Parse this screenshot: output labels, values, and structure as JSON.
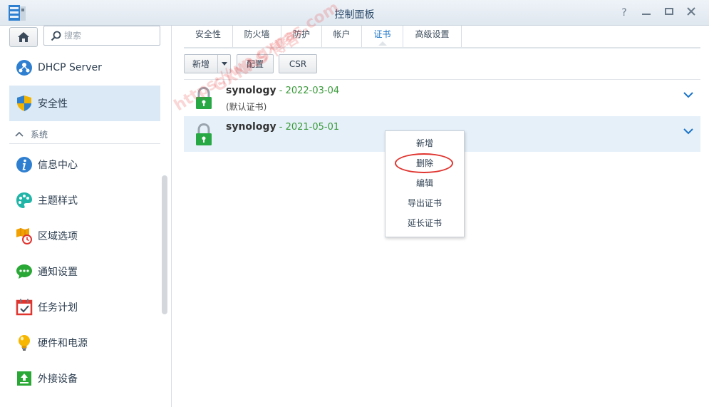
{
  "window": {
    "title": "控制面板",
    "controls": [
      "help-icon",
      "minimize-icon",
      "maximize-icon",
      "close-icon"
    ]
  },
  "sidebar": {
    "search_placeholder": "搜索",
    "items_top": [
      {
        "label": "DHCP Server",
        "icon": "dhcp-network-icon"
      },
      {
        "label": "安全性",
        "icon": "security-shield-icon",
        "active": true
      }
    ],
    "section": {
      "label": "系统",
      "icon": "chevron-up-icon"
    },
    "items": [
      {
        "label": "信息中心",
        "icon": "info-center-icon"
      },
      {
        "label": "主题样式",
        "icon": "theme-palette-icon"
      },
      {
        "label": "区域选项",
        "icon": "regional-options-icon"
      },
      {
        "label": "通知设置",
        "icon": "notification-chat-icon"
      },
      {
        "label": "任务计划",
        "icon": "task-scheduler-icon"
      },
      {
        "label": "硬件和电源",
        "icon": "hardware-power-bulb-icon"
      },
      {
        "label": "外接设备",
        "icon": "external-device-icon"
      }
    ]
  },
  "tabs": [
    {
      "label": "安全性"
    },
    {
      "label": "防火墙"
    },
    {
      "label": "防护"
    },
    {
      "label": "帐户"
    },
    {
      "label": "证书",
      "active": true
    },
    {
      "label": "高级设置"
    }
  ],
  "toolbar": {
    "new_label": "新增",
    "config_label": "配置",
    "csr_label": "CSR"
  },
  "certificates": [
    {
      "name": "synology",
      "date": " - 2022-03-04",
      "sub": "(默认证书)"
    },
    {
      "name": "synology",
      "date": " - 2021-05-01",
      "sub": ""
    }
  ],
  "context_menu": {
    "items": [
      "新增",
      "删除",
      "编辑",
      "导出证书",
      "延长证书"
    ],
    "highlighted_index": 1
  },
  "watermark": {
    "line1": "GXNAS 博客",
    "line2": "https://wp.gxnas.com"
  },
  "colors": {
    "accent": "#1a73c8",
    "cert_date": "#3a9a3a",
    "lock_green": "#27a844",
    "highlight_circle": "#e0342f",
    "sidebar_active": "#dbe9f6"
  }
}
